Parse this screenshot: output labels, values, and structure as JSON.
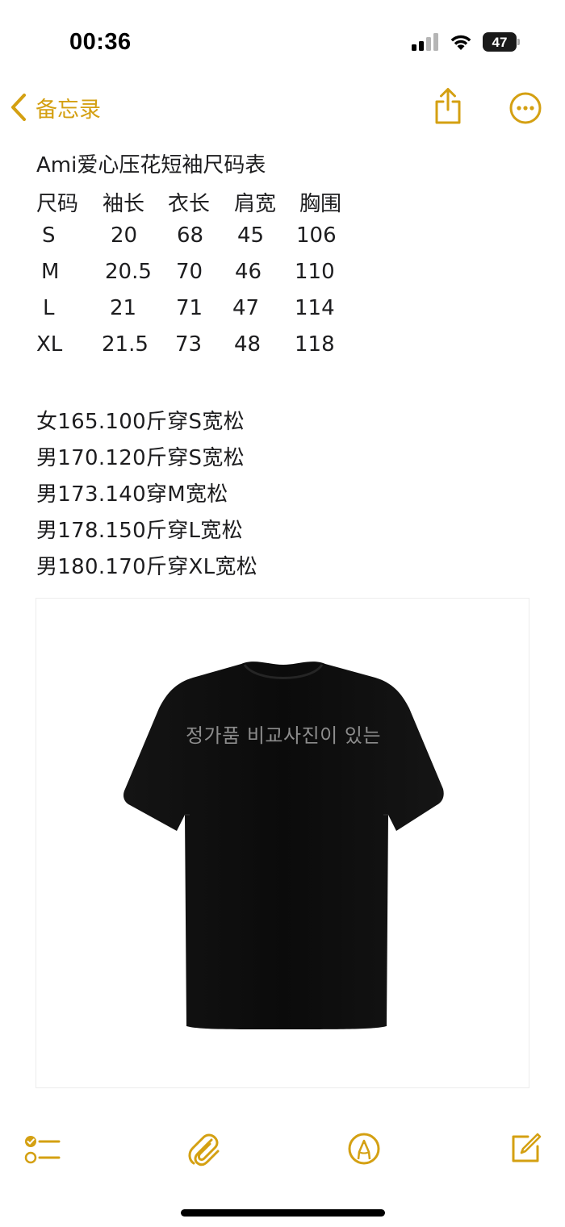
{
  "status_bar": {
    "time": "00:36",
    "battery_level": "47",
    "icons": [
      "signal-icon",
      "wifi-icon",
      "battery-icon"
    ]
  },
  "nav": {
    "back_label": "备忘录",
    "icons": [
      "chevron-left-icon",
      "share-icon",
      "more-icon"
    ]
  },
  "note": {
    "title": "Ami爱心压花短袖尺码表",
    "table": {
      "headers": [
        "尺码",
        "袖长",
        "衣长",
        "肩宽",
        "胸围"
      ],
      "rows": [
        [
          "S",
          "20",
          "68",
          "45",
          "106"
        ],
        [
          "M",
          "20.5",
          "70",
          "46",
          "110"
        ],
        [
          "L",
          "21",
          "71",
          "47",
          "114"
        ],
        [
          "XL",
          "21.5",
          "73",
          "48",
          "118"
        ]
      ]
    },
    "fit_lines": [
      "女165.100斤穿S宽松",
      "男170.120斤穿S宽松",
      "男173.140穿M宽松",
      "男178.150斤穿L宽松",
      "男180.170斤穿XL宽松"
    ],
    "image": {
      "overlay_text": "정가품 비교사진이 있는"
    }
  },
  "toolbar": {
    "icons": [
      "checklist-icon",
      "attachment-icon",
      "markup-icon",
      "compose-icon"
    ]
  },
  "colors": {
    "accent": "#d4a012",
    "text": "#1d1d1f",
    "shirt": "#0a0a0a"
  }
}
